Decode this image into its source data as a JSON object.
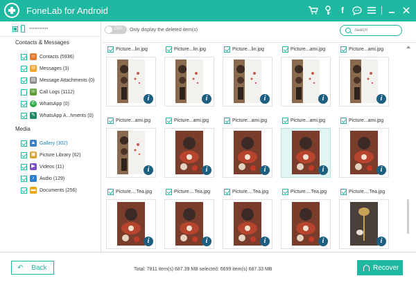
{
  "window": {
    "title": "FoneLab for Android",
    "accent": "#1fb8a0",
    "icons": [
      "cart-icon",
      "key-icon",
      "facebook-icon",
      "chat-icon",
      "menu-icon",
      "minimize-icon",
      "close-icon"
    ]
  },
  "sidebar": {
    "device": {
      "name": "▪▪▪▪▪▪▪▪▪▪▪",
      "checked": true
    },
    "sections": [
      {
        "title": "Contacts & Messages",
        "items": [
          {
            "label": "Contacts (5936)",
            "checked": true,
            "icon": "contacts-icon"
          },
          {
            "label": "Messages (3)",
            "checked": true,
            "icon": "messages-icon"
          },
          {
            "label": "Message Attachments (0)",
            "checked": true,
            "icon": "attachment-icon"
          },
          {
            "label": "Call Logs (1112)",
            "checked": false,
            "icon": "call-logs-icon"
          },
          {
            "label": "WhatsApp (0)",
            "checked": true,
            "icon": "whatsapp-icon"
          },
          {
            "label": "WhatsApp A...hments (0)",
            "checked": true,
            "icon": "whatsapp-attachments-icon"
          }
        ]
      },
      {
        "title": "Media",
        "items": [
          {
            "label": "Gallery (302)",
            "checked": true,
            "icon": "gallery-icon",
            "active": true
          },
          {
            "label": "Picture Library (62)",
            "checked": true,
            "icon": "picture-library-icon"
          },
          {
            "label": "Videos (11)",
            "checked": true,
            "icon": "videos-icon"
          },
          {
            "label": "Audio (129)",
            "checked": true,
            "icon": "audio-icon"
          },
          {
            "label": "Documents (256)",
            "checked": true,
            "icon": "documents-icon"
          }
        ]
      }
    ]
  },
  "toolbar": {
    "toggle_state": "OFF",
    "toggle_label": "Only display the deleted item(s)",
    "search_placeholder": "Search"
  },
  "gallery": {
    "items": [
      {
        "name": "Picture...lin.jpg",
        "checked": true,
        "photo": "tea-white"
      },
      {
        "name": "Picture...lin.jpg",
        "checked": true,
        "photo": "tea-white"
      },
      {
        "name": "Picture...lin.jpg",
        "checked": true,
        "photo": "tea-white"
      },
      {
        "name": "Picture...ami.jpg",
        "checked": true,
        "photo": "tea-white"
      },
      {
        "name": "Picture...ami.jpg",
        "checked": true,
        "photo": "tea-white"
      },
      {
        "name": "Picture...ami.jpg",
        "checked": true,
        "photo": "tea-white"
      },
      {
        "name": "Picture...ami.jpg",
        "checked": true,
        "photo": "tea-red"
      },
      {
        "name": "Picture...ami.jpg",
        "checked": true,
        "photo": "tea-red"
      },
      {
        "name": "Picture...ami.jpg",
        "checked": true,
        "photo": "tea-red",
        "selected": true
      },
      {
        "name": "Picture...ami.jpg",
        "checked": true,
        "photo": "tea-red"
      },
      {
        "name": "Picture....Tea.jpg",
        "checked": true,
        "photo": "tea-red"
      },
      {
        "name": "Picture....Tea.jpg",
        "checked": true,
        "photo": "tea-red"
      },
      {
        "name": "Picture....Tea.jpg",
        "checked": true,
        "photo": "tea-red"
      },
      {
        "name": "Picture....Tea.jpg",
        "checked": true,
        "photo": "tea-red"
      },
      {
        "name": "Picture....Tea.jpg",
        "checked": true,
        "photo": "tea-dark"
      }
    ]
  },
  "footer": {
    "back_label": "Back",
    "totals": "Total: 7811 item(s) 687.39 MB   selected: 6699 item(s) 687.33 MB",
    "recover_label": "Recover"
  }
}
